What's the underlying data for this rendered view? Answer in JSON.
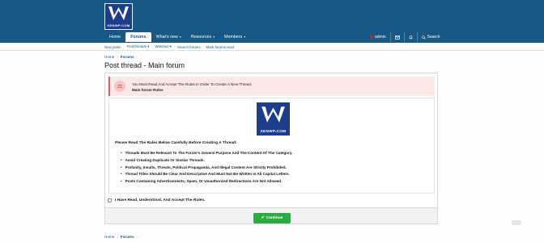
{
  "brand": {
    "logo_text": "XENWP.COM"
  },
  "nav": {
    "tabs": [
      {
        "label": "Home",
        "caret": ""
      },
      {
        "label": "Forums",
        "caret": ""
      },
      {
        "label": "What's new",
        "caret": "▾"
      },
      {
        "label": "Resources",
        "caret": "▾"
      },
      {
        "label": "Members",
        "caret": "▾"
      }
    ]
  },
  "user": {
    "name": "admin",
    "search_label": "Search"
  },
  "subnav": [
    "New posts",
    "Find threads",
    "Watched",
    "Search forums",
    "Mark forums read"
  ],
  "breadcrumb": {
    "home": "Home",
    "sep": "›",
    "forums": "Forums"
  },
  "page": {
    "title": "Post thread - Main forum"
  },
  "notice": {
    "line1": "You Must Read And Accept The Rules In Order To Create A New Thread.",
    "line2": "Main forum Rules"
  },
  "rules": {
    "intro": "Please Read The Rules Below Carefully Before Creating A Thread:",
    "items": [
      "Threads Must Be Relevant To The Forum's General Purpose And The Content Of The Category.",
      "Avoid Creating Duplicate Or Similar Threads.",
      "Profanity, Insults, Threats, Political Propaganda, And Illegal Content Are Strictly Prohibited.",
      "Thread Titles Should Be Clear And Descriptive And Must Not Be Written In All Capital Letters.",
      "Posts Containing Advertisements, Spam, Or Unauthorized Redirections Are Not Allowed."
    ]
  },
  "agree": {
    "label": "I Have Read, Understood, And Accept The Rules."
  },
  "actions": {
    "continue_label": "Continue"
  },
  "colors": {
    "header": "#185886",
    "logo": "#1c3c8c",
    "notice": "#fde8e8",
    "continue": "#2daa42"
  }
}
